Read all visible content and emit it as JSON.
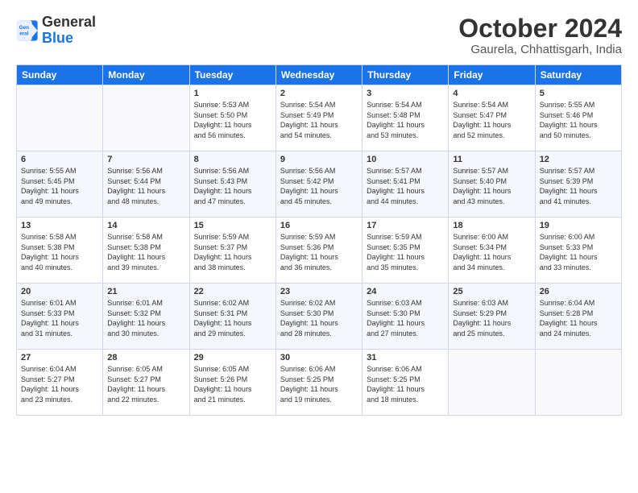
{
  "header": {
    "logo_general": "General",
    "logo_blue": "Blue",
    "month": "October 2024",
    "location": "Gaurela, Chhattisgarh, India"
  },
  "columns": [
    "Sunday",
    "Monday",
    "Tuesday",
    "Wednesday",
    "Thursday",
    "Friday",
    "Saturday"
  ],
  "weeks": [
    [
      {
        "day": "",
        "content": ""
      },
      {
        "day": "",
        "content": ""
      },
      {
        "day": "1",
        "content": "Sunrise: 5:53 AM\nSunset: 5:50 PM\nDaylight: 11 hours\nand 56 minutes."
      },
      {
        "day": "2",
        "content": "Sunrise: 5:54 AM\nSunset: 5:49 PM\nDaylight: 11 hours\nand 54 minutes."
      },
      {
        "day": "3",
        "content": "Sunrise: 5:54 AM\nSunset: 5:48 PM\nDaylight: 11 hours\nand 53 minutes."
      },
      {
        "day": "4",
        "content": "Sunrise: 5:54 AM\nSunset: 5:47 PM\nDaylight: 11 hours\nand 52 minutes."
      },
      {
        "day": "5",
        "content": "Sunrise: 5:55 AM\nSunset: 5:46 PM\nDaylight: 11 hours\nand 50 minutes."
      }
    ],
    [
      {
        "day": "6",
        "content": "Sunrise: 5:55 AM\nSunset: 5:45 PM\nDaylight: 11 hours\nand 49 minutes."
      },
      {
        "day": "7",
        "content": "Sunrise: 5:56 AM\nSunset: 5:44 PM\nDaylight: 11 hours\nand 48 minutes."
      },
      {
        "day": "8",
        "content": "Sunrise: 5:56 AM\nSunset: 5:43 PM\nDaylight: 11 hours\nand 47 minutes."
      },
      {
        "day": "9",
        "content": "Sunrise: 5:56 AM\nSunset: 5:42 PM\nDaylight: 11 hours\nand 45 minutes."
      },
      {
        "day": "10",
        "content": "Sunrise: 5:57 AM\nSunset: 5:41 PM\nDaylight: 11 hours\nand 44 minutes."
      },
      {
        "day": "11",
        "content": "Sunrise: 5:57 AM\nSunset: 5:40 PM\nDaylight: 11 hours\nand 43 minutes."
      },
      {
        "day": "12",
        "content": "Sunrise: 5:57 AM\nSunset: 5:39 PM\nDaylight: 11 hours\nand 41 minutes."
      }
    ],
    [
      {
        "day": "13",
        "content": "Sunrise: 5:58 AM\nSunset: 5:38 PM\nDaylight: 11 hours\nand 40 minutes."
      },
      {
        "day": "14",
        "content": "Sunrise: 5:58 AM\nSunset: 5:38 PM\nDaylight: 11 hours\nand 39 minutes."
      },
      {
        "day": "15",
        "content": "Sunrise: 5:59 AM\nSunset: 5:37 PM\nDaylight: 11 hours\nand 38 minutes."
      },
      {
        "day": "16",
        "content": "Sunrise: 5:59 AM\nSunset: 5:36 PM\nDaylight: 11 hours\nand 36 minutes."
      },
      {
        "day": "17",
        "content": "Sunrise: 5:59 AM\nSunset: 5:35 PM\nDaylight: 11 hours\nand 35 minutes."
      },
      {
        "day": "18",
        "content": "Sunrise: 6:00 AM\nSunset: 5:34 PM\nDaylight: 11 hours\nand 34 minutes."
      },
      {
        "day": "19",
        "content": "Sunrise: 6:00 AM\nSunset: 5:33 PM\nDaylight: 11 hours\nand 33 minutes."
      }
    ],
    [
      {
        "day": "20",
        "content": "Sunrise: 6:01 AM\nSunset: 5:33 PM\nDaylight: 11 hours\nand 31 minutes."
      },
      {
        "day": "21",
        "content": "Sunrise: 6:01 AM\nSunset: 5:32 PM\nDaylight: 11 hours\nand 30 minutes."
      },
      {
        "day": "22",
        "content": "Sunrise: 6:02 AM\nSunset: 5:31 PM\nDaylight: 11 hours\nand 29 minutes."
      },
      {
        "day": "23",
        "content": "Sunrise: 6:02 AM\nSunset: 5:30 PM\nDaylight: 11 hours\nand 28 minutes."
      },
      {
        "day": "24",
        "content": "Sunrise: 6:03 AM\nSunset: 5:30 PM\nDaylight: 11 hours\nand 27 minutes."
      },
      {
        "day": "25",
        "content": "Sunrise: 6:03 AM\nSunset: 5:29 PM\nDaylight: 11 hours\nand 25 minutes."
      },
      {
        "day": "26",
        "content": "Sunrise: 6:04 AM\nSunset: 5:28 PM\nDaylight: 11 hours\nand 24 minutes."
      }
    ],
    [
      {
        "day": "27",
        "content": "Sunrise: 6:04 AM\nSunset: 5:27 PM\nDaylight: 11 hours\nand 23 minutes."
      },
      {
        "day": "28",
        "content": "Sunrise: 6:05 AM\nSunset: 5:27 PM\nDaylight: 11 hours\nand 22 minutes."
      },
      {
        "day": "29",
        "content": "Sunrise: 6:05 AM\nSunset: 5:26 PM\nDaylight: 11 hours\nand 21 minutes."
      },
      {
        "day": "30",
        "content": "Sunrise: 6:06 AM\nSunset: 5:25 PM\nDaylight: 11 hours\nand 19 minutes."
      },
      {
        "day": "31",
        "content": "Sunrise: 6:06 AM\nSunset: 5:25 PM\nDaylight: 11 hours\nand 18 minutes."
      },
      {
        "day": "",
        "content": ""
      },
      {
        "day": "",
        "content": ""
      }
    ]
  ]
}
